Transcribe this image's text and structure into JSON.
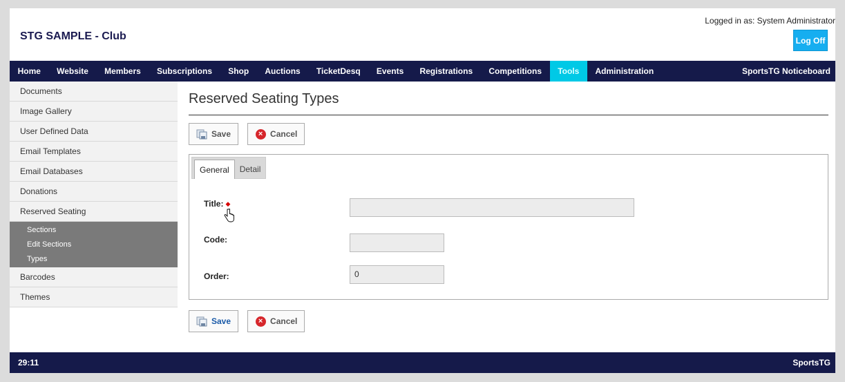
{
  "header": {
    "site_title": "STG SAMPLE - Club",
    "logged_in": "Logged in as: System Administrator",
    "logoff": "Log Off"
  },
  "nav": {
    "items": [
      "Home",
      "Website",
      "Members",
      "Subscriptions",
      "Shop",
      "Auctions",
      "TicketDesq",
      "Events",
      "Registrations",
      "Competitions",
      "Tools",
      "Administration"
    ],
    "active": "Tools",
    "right": "SportsTG Noticeboard"
  },
  "sidebar": {
    "items_top": [
      "Documents",
      "Image Gallery",
      "User Defined Data",
      "Email Templates",
      "Email Databases",
      "Donations",
      "Reserved Seating"
    ],
    "sub_items": [
      "Sections",
      "Edit Sections",
      "Types"
    ],
    "items_bottom": [
      "Barcodes",
      "Themes"
    ]
  },
  "main": {
    "title": "Reserved Seating Types",
    "save_label": "Save",
    "cancel_label": "Cancel",
    "tabs": [
      "General",
      "Detail"
    ],
    "active_tab": "General",
    "fields": {
      "title_label": "Title:",
      "title_value": "",
      "code_label": "Code:",
      "code_value": "",
      "order_label": "Order:",
      "order_value": "0"
    }
  },
  "footer": {
    "left": "29:11",
    "right": "SportsTG"
  },
  "colors": {
    "nav_bg": "#151a4a",
    "active_nav": "#00c9e6",
    "logoff_bg": "#16aef0",
    "required": "#d60000",
    "cancel_icon": "#d6262b"
  }
}
